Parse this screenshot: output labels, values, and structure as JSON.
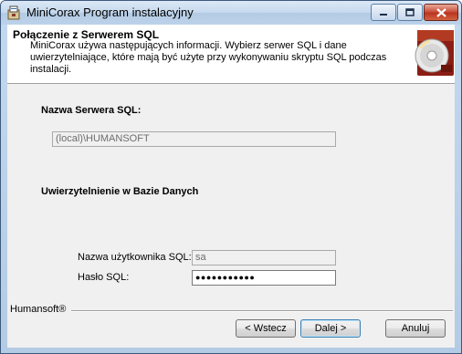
{
  "window": {
    "title": "MiniCorax Program instalacyjny",
    "app_icon": "installer-icon",
    "controls": [
      "minimize-icon",
      "maximize-icon",
      "close-icon"
    ]
  },
  "banner": {
    "title": "Połączenie z Serwerem SQL",
    "description": "MiniCorax używa następujących informacji. Wybierz serwer SQL i dane uwierzytelniające, które mają być użyte przy wykonywaniu skryptu SQL podczas instalacji.",
    "logo": "cd-disc-logo-icon"
  },
  "server": {
    "heading": "Nazwa Serwera SQL:",
    "value": "(local)\\HUMANSOFT"
  },
  "auth": {
    "heading": "Uwierzytelnienie w Bazie Danych",
    "username_label": "Nazwa użytkownika SQL:",
    "username_value": "sa",
    "password_label": "Hasło SQL:",
    "password_value": "●●●●●●●●●●●"
  },
  "footer": {
    "brand": "Humansoft®",
    "back_label": "< Wstecz",
    "next_label": "Dalej >",
    "cancel_label": "Anuluj"
  },
  "colors": {
    "titlebar": "#c6d9ee",
    "dialog_bg": "#f0f0f0",
    "close_button": "#c74a35"
  }
}
